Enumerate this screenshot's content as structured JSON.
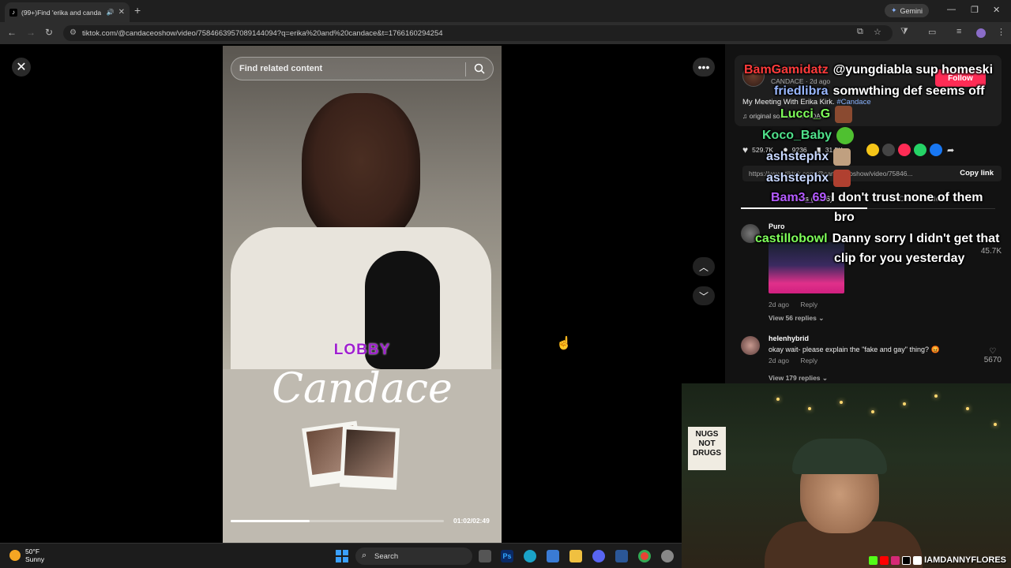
{
  "browser": {
    "tab_title": "(99+)Find 'erika and canda",
    "gemini_label": "Gemini",
    "url": "tiktok.com/@candaceoshow/video/7584663957089144094?q=erika%20and%20candace&t=1766160294254"
  },
  "player": {
    "search_placeholder": "Find related content",
    "overlay_top_text": "LOBBY",
    "signature_text": "Candace",
    "timecode": "01:02/02:49",
    "progress_fraction": 0.37
  },
  "post": {
    "username": "candaceoshow",
    "subline": "CANDACE · 2d ago",
    "follow_label": "Follow",
    "description": "My Meeting With Erika Kirk.",
    "hashtag": "#Candace",
    "sound": "original sound - CANDA...",
    "likes": "529.7K",
    "comments_count": "9236",
    "saves": "31.5K",
    "link": "https://www.tiktok.com/@candaceoshow/video/75846...",
    "copy_link_label": "Copy link",
    "tab_comments": "Comments (9236)",
    "tab_creator": "Creator videos"
  },
  "comments": [
    {
      "user": "Puro",
      "text": "",
      "age": "2d ago",
      "reply_label": "Reply",
      "view_replies": "View 56 replies",
      "likes": "45.7K"
    },
    {
      "user": "helenhybrid",
      "text": "okay wait- please explain the \"fake and gay\" thing? 😡",
      "age": "2d ago",
      "reply_label": "Reply",
      "view_replies": "View 179 replies",
      "likes": "5670"
    }
  ],
  "chat": [
    {
      "name": "BamGamidatz",
      "name_color": "#ff3b3b",
      "msg": "@yungdiabla sup homeski"
    },
    {
      "name": "friedlibra",
      "name_color": "#9ab8ff",
      "msg": "somwthing def seems off"
    },
    {
      "name": "Lucci_G",
      "name_color": "#7fff5a",
      "msg": ""
    },
    {
      "name": "Koco_Baby",
      "name_color": "#4fe08a",
      "msg": ""
    },
    {
      "name": "ashstephx",
      "name_color": "#c8d8ff",
      "msg": ""
    },
    {
      "name": "ashstephx",
      "name_color": "#c8d8ff",
      "msg": ""
    },
    {
      "name": "Bam3_69",
      "name_color": "#b45aff",
      "msg": "I don't trust none of them"
    },
    {
      "name": "",
      "name_color": "#ffffff",
      "msg": "bro"
    },
    {
      "name": "castillobowl",
      "name_color": "#7fff5a",
      "msg": "Danny sorry I didn't get that"
    },
    {
      "name": "",
      "name_color": "#ffffff",
      "msg": "clip for you yesterday"
    }
  ],
  "webcam": {
    "sign_text_1": "NUGS",
    "sign_text_2": "NOT",
    "sign_text_3": "DRUGS",
    "handle": "IAMDANNYFLORES"
  },
  "taskbar": {
    "temperature": "50°F",
    "condition": "Sunny",
    "search_label": "Search"
  },
  "icons": {
    "close": "close-icon",
    "more": "more-icon",
    "search": "search-icon",
    "heart": "heart-icon",
    "comment": "comment-icon",
    "bookmark": "bookmark-icon"
  }
}
